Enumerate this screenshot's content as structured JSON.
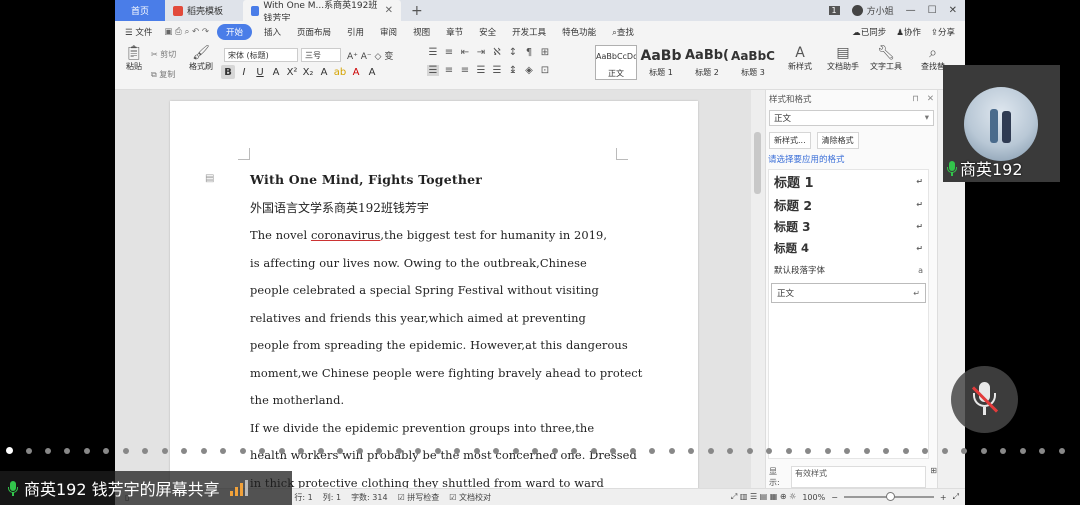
{
  "tabs": {
    "home": "首页",
    "docer": "稻壳模板",
    "doc": "With One M...系商英192班钱芳宇",
    "doc_close": "✕",
    "plus": "+",
    "right_badge": "1",
    "user": "方小姐",
    "min": "—",
    "max": "☐",
    "close": "✕"
  },
  "menu": {
    "file": "☰ 文件",
    "start": "开始",
    "items": [
      "插入",
      "页面布局",
      "引用",
      "审阅",
      "视图",
      "章节",
      "安全",
      "开发工具",
      "特色功能"
    ],
    "search": "查找",
    "sync": "已同步",
    "collab": "协作",
    "share": "分享"
  },
  "ribbon": {
    "paste": "粘贴",
    "cut": "剪切",
    "copy": "复制",
    "format_painter": "格式刷",
    "font": "宋体 (标题)",
    "size": "三号",
    "styles": [
      {
        "preview": "AaBbCcDd",
        "label": "正文"
      },
      {
        "preview": "AaBb",
        "label": "标题 1"
      },
      {
        "preview": "AaBb(",
        "label": "标题 2"
      },
      {
        "preview": "AaBbC",
        "label": "标题 3"
      }
    ],
    "new_style": "新样式",
    "doc_helper": "文档助手",
    "text_tools": "文字工具",
    "find_replace": "查找替"
  },
  "document": {
    "title": "With One Mind, Fights Together",
    "subtitle": "外国语言文学系商英192班钱芳宇",
    "lines": [
      [
        "The novel ",
        "coronavirus",
        ",the biggest test for humanity in 2019,"
      ],
      [
        "is affecting our lives now. Owing to the outbreak,Chinese",
        "",
        ""
      ],
      [
        "people celebrated a special Spring Festival without visiting",
        "",
        ""
      ],
      [
        "relatives and friends this year,which aimed at preventing",
        "",
        ""
      ],
      [
        "people from spreading the epidemic. However,at this dangerous",
        "",
        ""
      ],
      [
        "moment,we Chinese people were fighting bravely ahead to protect",
        "",
        ""
      ],
      [
        "the motherland.",
        "",
        ""
      ],
      [
        "If we divide the epidemic prevention groups into three,the",
        "",
        ""
      ],
      [
        "health workers will probably be the most concerned one. Dressed",
        "",
        ""
      ],
      [
        "in thick protective clothing they shuttled from ward to ward",
        "",
        ""
      ]
    ]
  },
  "pane": {
    "title": "样式和格式",
    "current": "正文",
    "new_style": "新样式...",
    "clear_format": "清除格式",
    "hint": "请选择要应用的格式",
    "styles": [
      "标题 1",
      "标题 2",
      "标题 3",
      "标题 4"
    ],
    "default_font": "默认段落字体",
    "default_mark": "a",
    "normal": "正文",
    "show_label": "显示:",
    "show_value": "有效样式"
  },
  "status": {
    "line": "行: 1",
    "col": "列: 1",
    "words": "字数: 314",
    "spell": "拼写检查",
    "proof": "文档校对",
    "zoom": "100%",
    "minus": "−",
    "plus": "+"
  },
  "meeting": {
    "participant_name": "商英192",
    "share_label": "商英192  钱芳宇的屏幕共享"
  },
  "colors": {
    "accent": "#4a7de8",
    "mic_green": "#32c54b",
    "mute_red": "#e23b3b"
  }
}
